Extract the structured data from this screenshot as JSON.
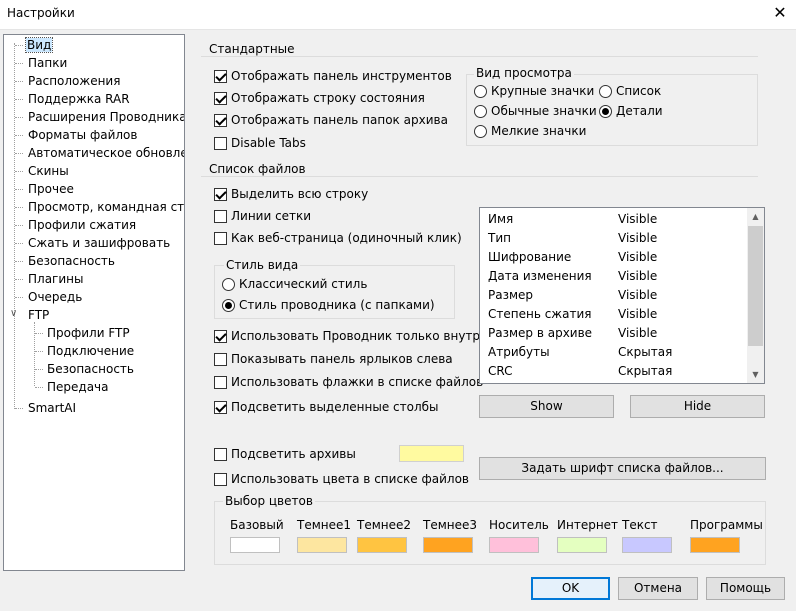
{
  "window": {
    "title": "Настройки",
    "close_glyph": "✕"
  },
  "tree": {
    "items": [
      {
        "label": "Вид"
      },
      {
        "label": "Папки"
      },
      {
        "label": "Расположения"
      },
      {
        "label": "Поддержка RAR"
      },
      {
        "label": "Расширения Проводника"
      },
      {
        "label": "Форматы файлов"
      },
      {
        "label": "Автоматическое обновлени"
      },
      {
        "label": "Скины"
      },
      {
        "label": "Прочее"
      },
      {
        "label": "Просмотр, командная строк"
      },
      {
        "label": "Профили сжатия"
      },
      {
        "label": "Сжать и зашифровать"
      },
      {
        "label": "Безопасность"
      },
      {
        "label": "Плагины"
      },
      {
        "label": "Очередь"
      },
      {
        "label": "FTP"
      },
      {
        "label": "Профили FTP"
      },
      {
        "label": "Подключение"
      },
      {
        "label": "Безопасность"
      },
      {
        "label": "Передача"
      },
      {
        "label": "SmartAI"
      }
    ],
    "ftp_toggle": "∨"
  },
  "standard": {
    "title": "Стандартные",
    "show_toolbar": "Отображать панель инструментов",
    "show_statusbar": "Отображать строку состояния",
    "show_folder_panel": "Отображать панель папок архива",
    "disable_tabs": "Disable Tabs"
  },
  "view_mode": {
    "title": "Вид просмотра",
    "large_icons": "Крупные значки",
    "normal_icons": "Обычные значки",
    "small_icons": "Мелкие значки",
    "list": "Список",
    "details": "Детали"
  },
  "file_list": {
    "title": "Список файлов",
    "select_row": "Выделить всю строку",
    "grid_lines": "Линии сетки",
    "web_page": "Как веб-страница (одиночный клик)",
    "use_explorer": "Использовать Проводник только внутри а",
    "show_shortcuts": "Показывать панель ярлыков слева",
    "use_checkboxes": "Использовать флажки в списке файлов",
    "highlight_columns": "Подсветить выделенные столбы",
    "highlight_archives": "Подсветить архивы",
    "use_colors": "Использовать цвета в списке файлов"
  },
  "view_style": {
    "title": "Стиль вида",
    "classic": "Классический стиль",
    "explorer": "Стиль проводника (с папками)"
  },
  "columns": [
    {
      "name": "Имя",
      "state": "Visible"
    },
    {
      "name": "Тип",
      "state": "Visible"
    },
    {
      "name": "Шифрование",
      "state": "Visible"
    },
    {
      "name": "Дата изменения",
      "state": "Visible"
    },
    {
      "name": "Размер",
      "state": "Visible"
    },
    {
      "name": "Степень сжатия",
      "state": "Visible"
    },
    {
      "name": "Размер в архиве",
      "state": "Visible"
    },
    {
      "name": "Атрибуты",
      "state": "Скрытая"
    },
    {
      "name": "CRC",
      "state": "Скрытая"
    }
  ],
  "buttons": {
    "show": "Show",
    "hide": "Hide",
    "set_font": "Задать шрифт списка файлов...",
    "ok": "OK",
    "cancel": "Отмена",
    "help": "Помощь"
  },
  "colors": {
    "title": "Выбор цветов",
    "archive_highlight": "#fffaa0",
    "items": [
      {
        "label": "Базовый",
        "color": "#ffffff"
      },
      {
        "label": "Темнее1",
        "color": "#fde6a0"
      },
      {
        "label": "Темнее2",
        "color": "#ffc441"
      },
      {
        "label": "Темнее3",
        "color": "#ffa320"
      },
      {
        "label": "Носитель",
        "color": "#ffc0da"
      },
      {
        "label": "Интернет",
        "color": "#e4ffc0"
      },
      {
        "label": "Текст",
        "color": "#c8c8ff"
      },
      {
        "label": "Программы",
        "color": "#ffa320"
      }
    ]
  }
}
